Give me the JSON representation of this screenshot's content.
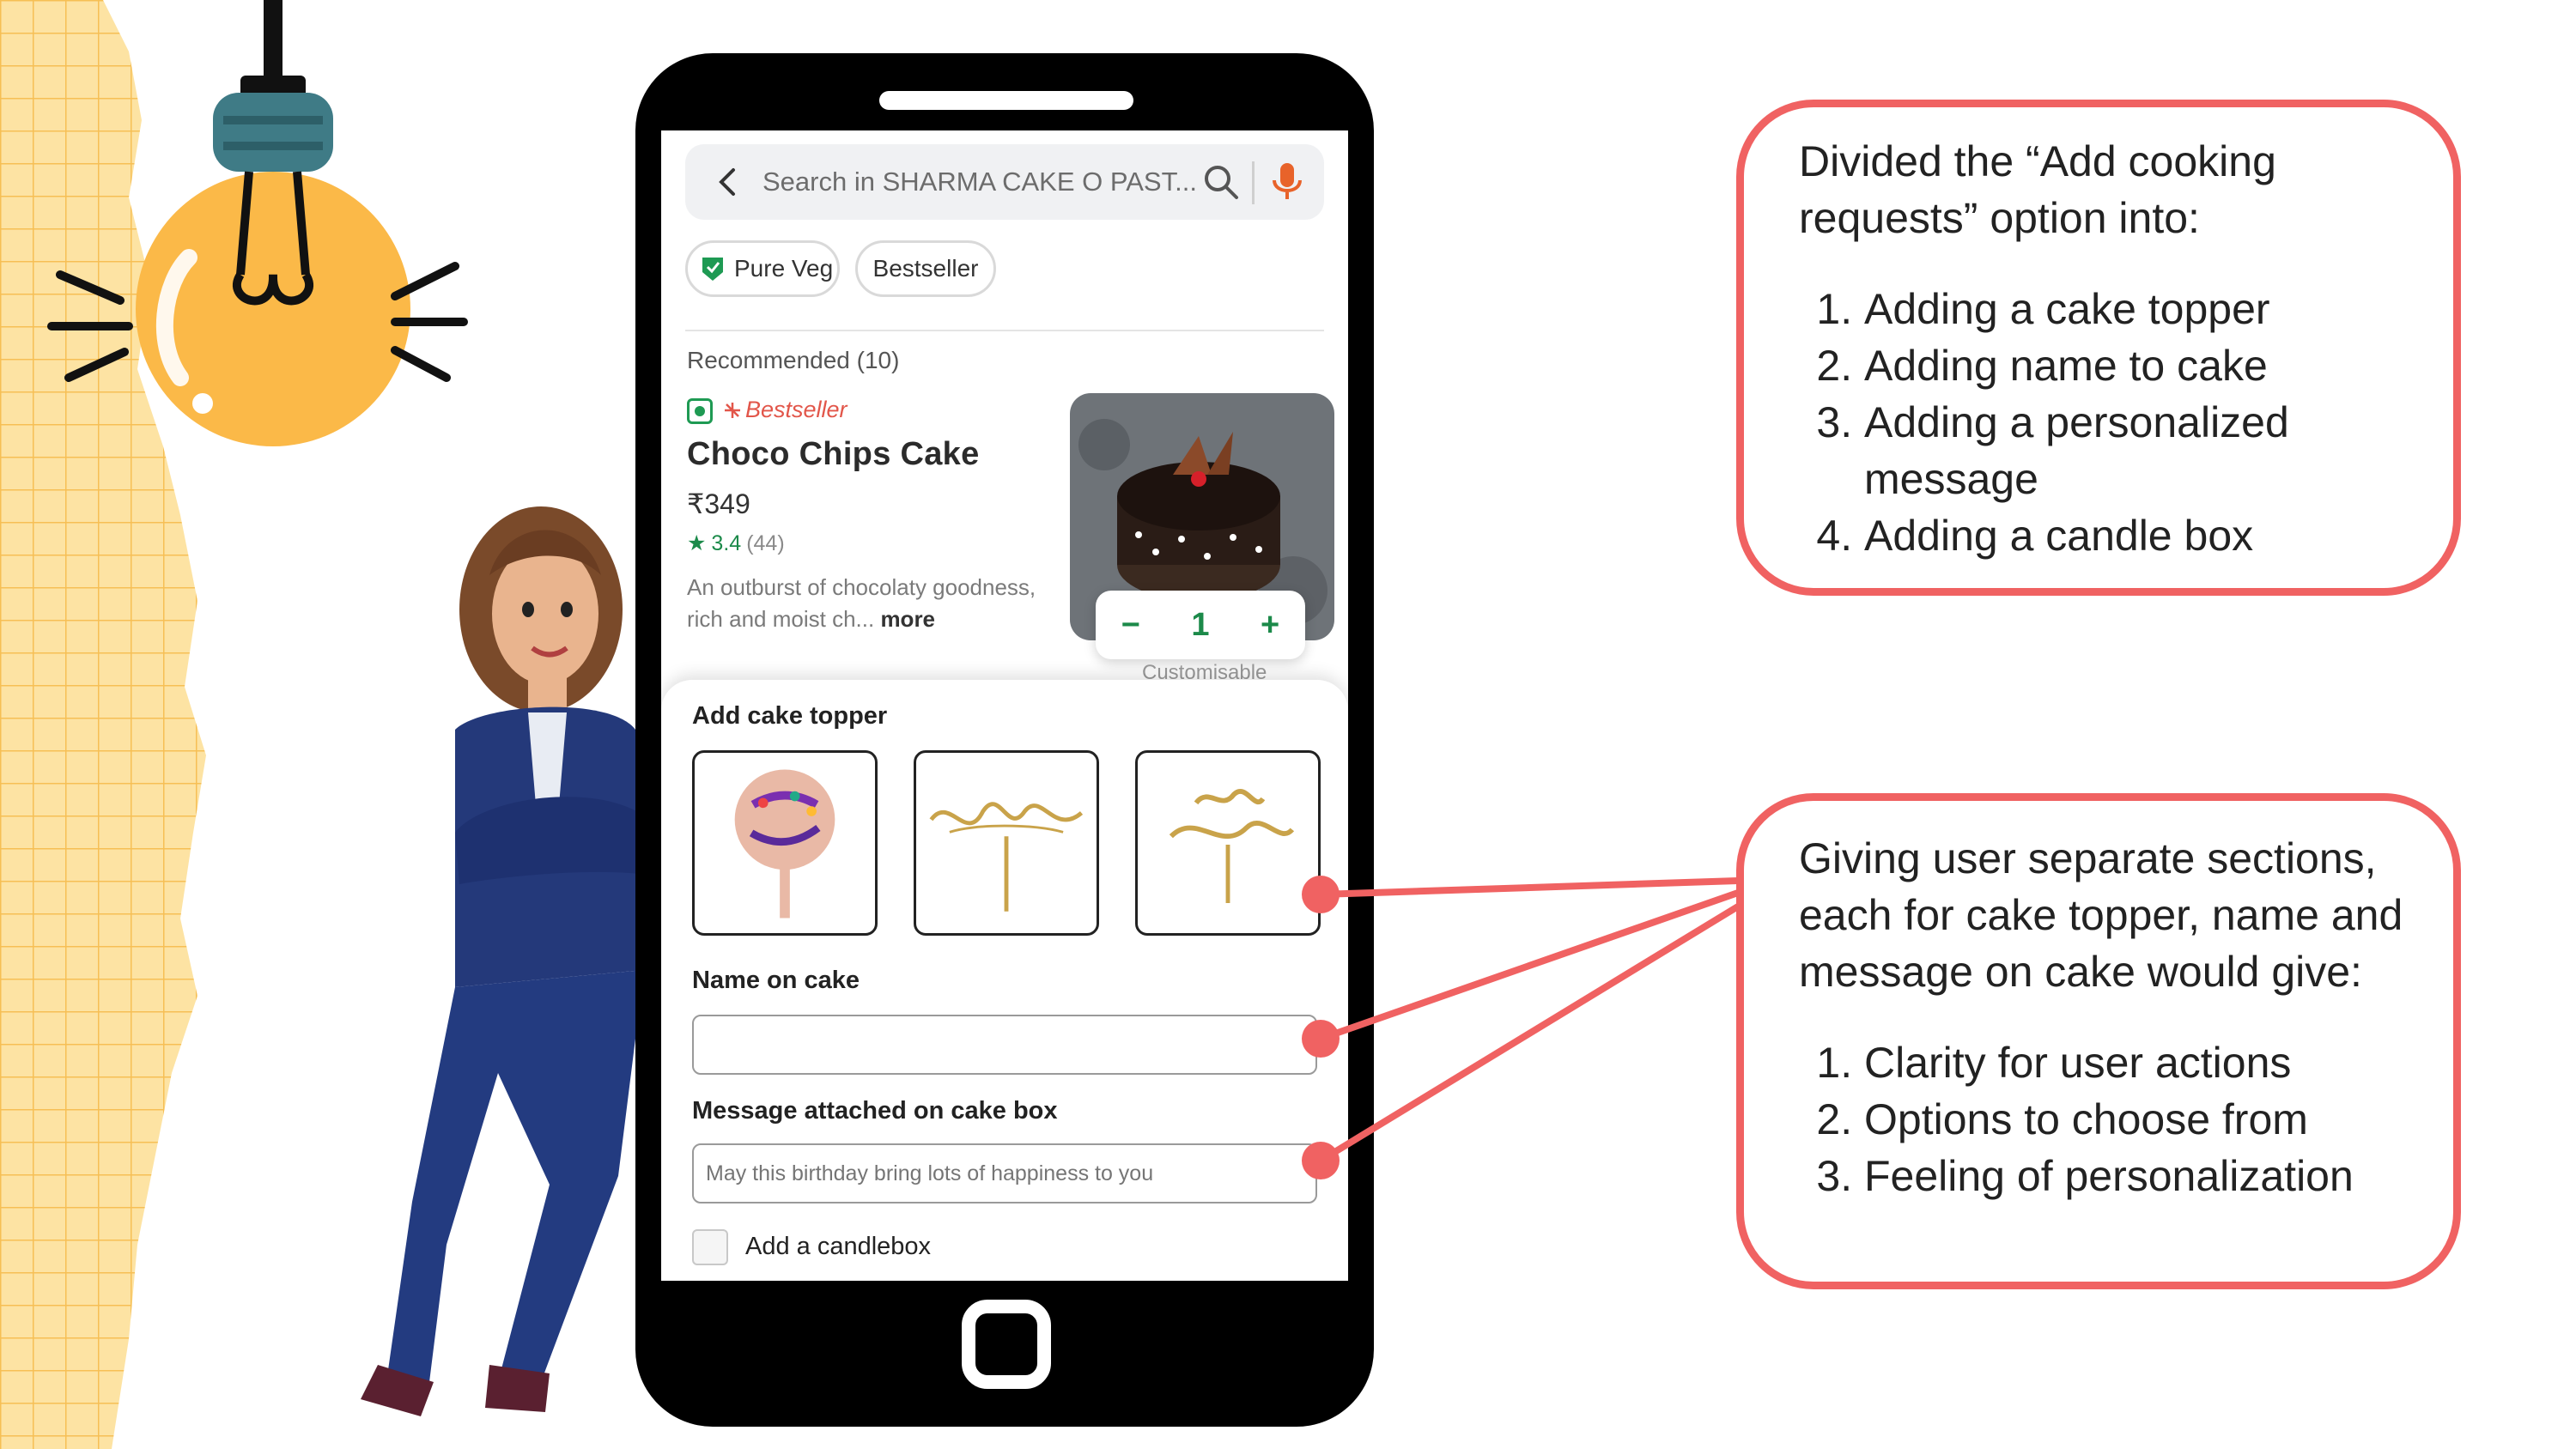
{
  "search": {
    "placeholder": "Search in SHARMA CAKE O PAST..."
  },
  "filters": [
    {
      "label": "Pure Veg"
    },
    {
      "label": "Bestseller"
    }
  ],
  "section": {
    "recommended_label": "Recommended (10)"
  },
  "product": {
    "tag": "Bestseller",
    "name": "Choco Chips Cake",
    "price": "₹349",
    "rating": "3.4",
    "rating_count": "(44)",
    "description": "An outburst of chocolaty goodness, rich and moist ch...",
    "more_label": "more",
    "quantity": "1",
    "customisable_label": "Customisable"
  },
  "sheet": {
    "topper_heading": "Add cake topper",
    "toppers": [
      {
        "icon": "happy-birthday-topper"
      },
      {
        "icon": "congratulations-topper"
      },
      {
        "icon": "happy-anniversary-topper"
      }
    ],
    "name_heading": "Name on cake",
    "name_value": "",
    "message_heading": "Message attached on cake box",
    "message_placeholder": "May this birthday bring lots of happiness to you",
    "candle_label": "Add a candlebox"
  },
  "callout_top": {
    "intro": "Divided the “Add cooking requests” option into:",
    "items": [
      "Adding a cake topper",
      "Adding name to cake",
      "Adding a personalized message",
      "Adding a candle box"
    ]
  },
  "callout_bottom": {
    "intro": "Giving user separate sections, each for cake topper, name and message on cake would give:",
    "items": [
      "Clarity for user actions",
      "Options to choose from",
      "Feeling of personalization"
    ]
  },
  "colors": {
    "accent_green": "#1e9a53",
    "accent_red": "#f06262",
    "mic_orange": "#e8632a",
    "bulb_yellow": "#fbb948",
    "grid_yellow": "#fde3a3"
  }
}
